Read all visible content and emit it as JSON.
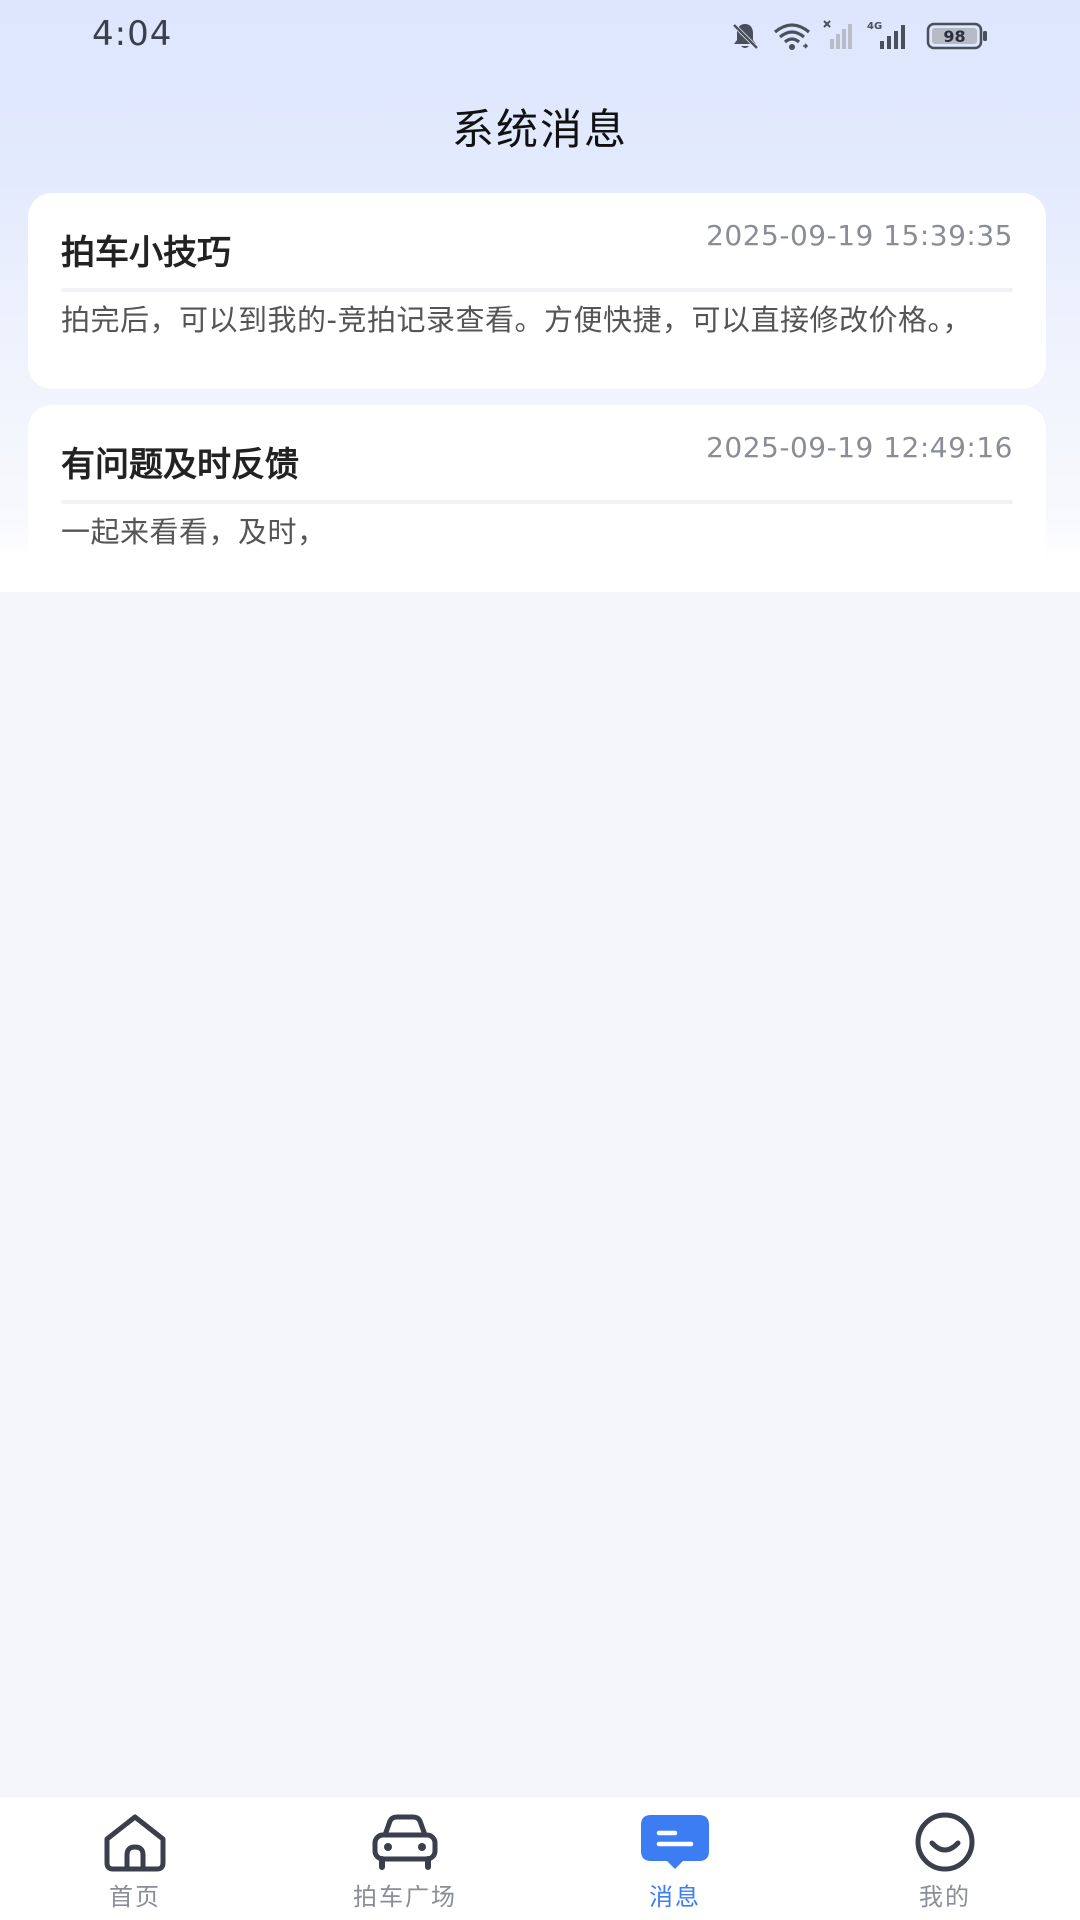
{
  "status_bar": {
    "time": "4:04",
    "battery": "98",
    "network_label": "4G",
    "icons": [
      "bell-off-icon",
      "wifi-icon",
      "signal-disabled-icon",
      "signal-4g-icon",
      "battery-icon"
    ]
  },
  "header": {
    "title": "系统消息"
  },
  "messages": [
    {
      "title": "拍车小技巧",
      "time": "2025-09-19 15:39:35",
      "body": "拍完后，可以到我的-竞拍记录查看。方便快捷，可以直接修改价格。，"
    },
    {
      "title": "有问题及时反馈",
      "time": "2025-09-19 12:49:16",
      "body": "一起来看看，及时，"
    }
  ],
  "tab_bar": {
    "active": "消息",
    "accent_color": "#3d7df4",
    "items": [
      {
        "label": "首页",
        "icon": "home-icon"
      },
      {
        "label": "拍车广场",
        "icon": "car-icon"
      },
      {
        "label": "消息",
        "icon": "message-icon"
      },
      {
        "label": "我的",
        "icon": "smile-icon"
      }
    ]
  }
}
